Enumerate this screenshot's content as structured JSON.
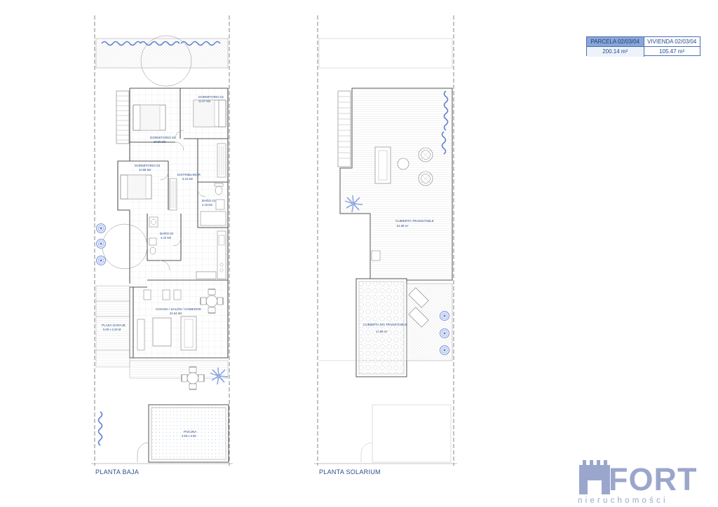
{
  "area_table": {
    "parcela_label": "PARCELA 02/03/04",
    "parcela_value": "200.14 m²",
    "vivienda_label": "VIVIENDA 02/03/04",
    "vivienda_value": "105.47 m²"
  },
  "planta_baja": {
    "title": "PLANTA BAJA",
    "rooms": {
      "dorm1_name": "DORMITORIO 01",
      "dorm1_area": "11.07 M2",
      "dorm2_name": "DORMITORIO 02",
      "dorm2_area": "10.60 M2",
      "dorm3_name": "DORMITORIO 03",
      "dorm3_area": "10.86 M2",
      "distribuidor_name": "DISTRIBUIDOR",
      "distribuidor_area": "5.10 M2",
      "bano1_name": "BAÑO 01",
      "bano1_area": "4.18 M2",
      "bano2_name": "BAÑO 02",
      "bano2_area": "4.42 M2",
      "cocina_name": "COCINA / SALÓN / COMEDOR",
      "cocina_area": "32.64 M2",
      "garaje_name": "PLAZA GARAJE",
      "garaje_area": "5.00 x 2.20 M",
      "piscina_name": "PISCINA",
      "piscina_area": "4.50 x 2.50"
    }
  },
  "planta_solarium": {
    "title": "PLANTA SOLARIUM",
    "rooms": {
      "transitable_name": "CUBIERTA TRANSITABLE",
      "transitable_area": "61.08 m²",
      "no_transitable_name": "CUBIERTA NO TRANSITABLE",
      "no_transitable_area": "17.86 m²"
    }
  },
  "logo": {
    "word": "FORT",
    "subtitle": "nieruchomości"
  },
  "colors": {
    "accent_blue": "#2a4f8c",
    "plant_blue": "#5f7fd1",
    "logo_grey": "#9ba6cc"
  }
}
